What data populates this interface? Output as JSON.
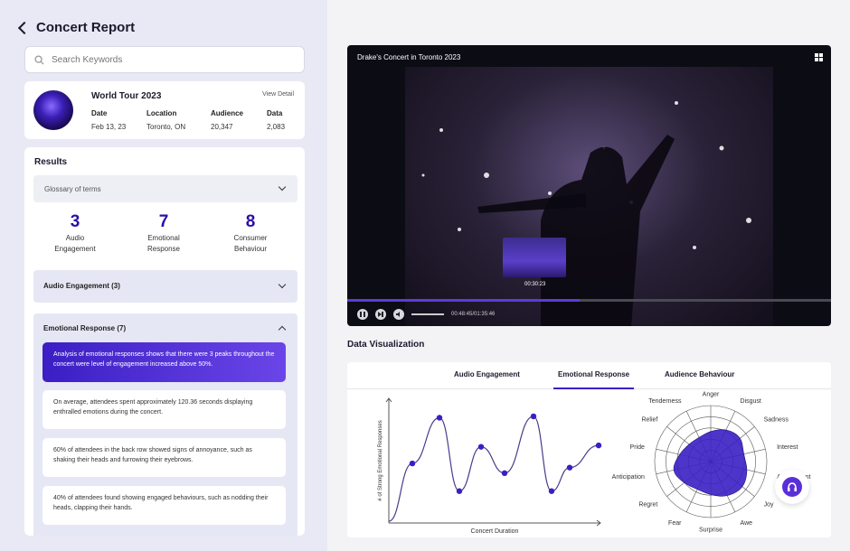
{
  "header": {
    "title": "Concert Report"
  },
  "search": {
    "placeholder": "Search Keywords"
  },
  "tour": {
    "name": "World Tour 2023",
    "view_detail": "View Detail",
    "fields": [
      {
        "label": "Date",
        "value": "Feb 13, 23"
      },
      {
        "label": "Location",
        "value": "Toronto, ON"
      },
      {
        "label": "Audience",
        "value": "20,347"
      },
      {
        "label": "Data",
        "value": "2,083"
      }
    ]
  },
  "results": {
    "title": "Results",
    "glossary": "Glossary of terms",
    "stats": [
      {
        "number": "3",
        "label1": "Audio",
        "label2": "Engagement"
      },
      {
        "number": "7",
        "label1": "Emotional",
        "label2": "Response"
      },
      {
        "number": "8",
        "label1": "Consumer",
        "label2": "Behaviour"
      }
    ],
    "audio_accordion": "Audio Engagement (3)",
    "emotional_accordion": "Emotional Response (7)",
    "cards": [
      "Analysis of emotional responses shows that there were 3 peaks throughout the concert were level of engagement increased above 50%.",
      "On average, attendees spent approximately 120.36 seconds displaying enthralled emotions during the concert.",
      "60% of attendees in the back row showed signs of annoyance, such as shaking their heads and furrowing their eyebrows.",
      "40% of attendees found showing engaged behaviours, such as nodding their heads, clapping their hands."
    ]
  },
  "video": {
    "title": "Drake's Concert in Toronto 2023",
    "preview_time": "00:30:23",
    "time": "00:48:45/01:35:46",
    "progress": 0.48,
    "icons": [
      "pause-icon",
      "skip-icon",
      "volume-icon",
      "grid-icon"
    ]
  },
  "data_viz": {
    "title": "Data Visualization",
    "tabs": [
      "Audio Engagement",
      "Emotional Response",
      "Audience Behaviour"
    ],
    "active_tab": "Emotional Response"
  },
  "chart_data": [
    {
      "type": "line",
      "xlabel": "Concert Duration",
      "ylabel": "# of Strong Emotional Responses",
      "x": [
        1,
        2,
        3,
        4,
        5,
        6,
        7,
        8,
        9
      ],
      "values": [
        4.3,
        7.6,
        2.3,
        5.5,
        3.6,
        7.7,
        2.3,
        4.0,
        5.6
      ],
      "ylim": [
        0,
        9
      ],
      "color": "#3a1fc4"
    },
    {
      "type": "radar",
      "categories": [
        "Anger",
        "Disgust",
        "Sadness",
        "Interest",
        "Amusement",
        "Joy",
        "Awe",
        "Surprise",
        "Fear",
        "Regret",
        "Anticipation",
        "Pride",
        "Relief",
        "Tenderness"
      ],
      "values": [
        0.55,
        0.65,
        0.7,
        0.6,
        0.68,
        0.75,
        0.7,
        0.6,
        0.55,
        0.62,
        0.72,
        0.58,
        0.5,
        0.48
      ],
      "max": 1,
      "color": "#3a1fc4"
    }
  ],
  "colors": {
    "accent": "#3a1fc4",
    "panel": "#e8e9f5"
  }
}
